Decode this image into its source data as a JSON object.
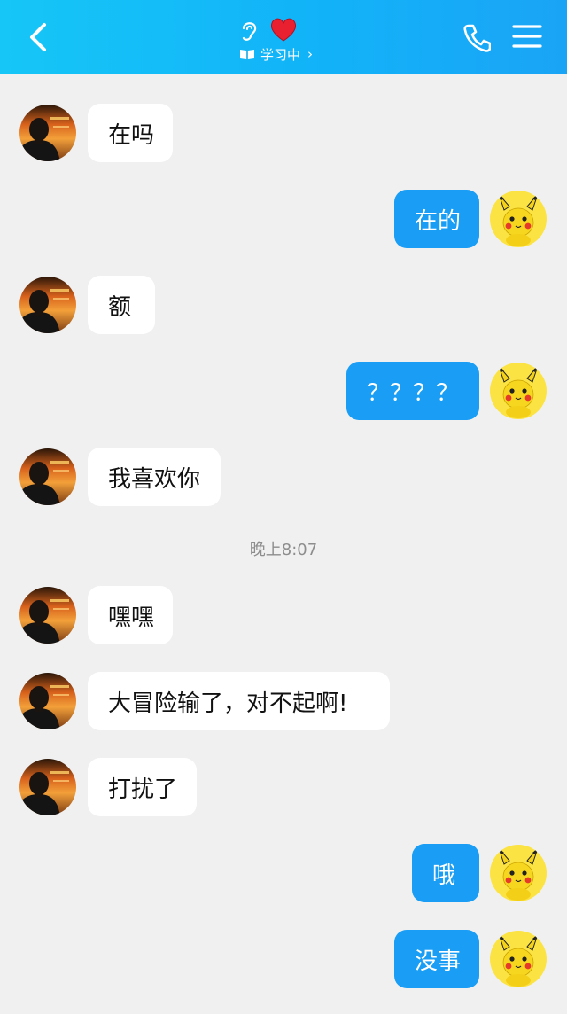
{
  "header": {
    "status_text": "学习中",
    "status_chevron": "›",
    "icons": {
      "back": "back-arrow-icon",
      "ear": "ear-icon",
      "heart": "heart-icon",
      "book": "book-icon",
      "phone": "phone-icon",
      "menu": "menu-icon"
    }
  },
  "colors": {
    "header_bg": "#16c6f7",
    "outgoing_bubble": "#1a9ef5",
    "incoming_bubble": "#ffffff",
    "chat_bg": "#f0f0f0"
  },
  "messages": [
    {
      "side": "in",
      "text": "在吗"
    },
    {
      "side": "out",
      "text": "在的"
    },
    {
      "side": "in",
      "text": "额"
    },
    {
      "side": "out",
      "text": "？？？？"
    },
    {
      "side": "in",
      "text": "我喜欢你"
    },
    {
      "side": "in",
      "text": "嘿嘿"
    },
    {
      "side": "in",
      "text": "大冒险输了，对不起啊!"
    },
    {
      "side": "in",
      "text": "打扰了"
    },
    {
      "side": "out",
      "text": "哦"
    },
    {
      "side": "out",
      "text": "没事"
    }
  ],
  "timestamp": "晚上8:07"
}
